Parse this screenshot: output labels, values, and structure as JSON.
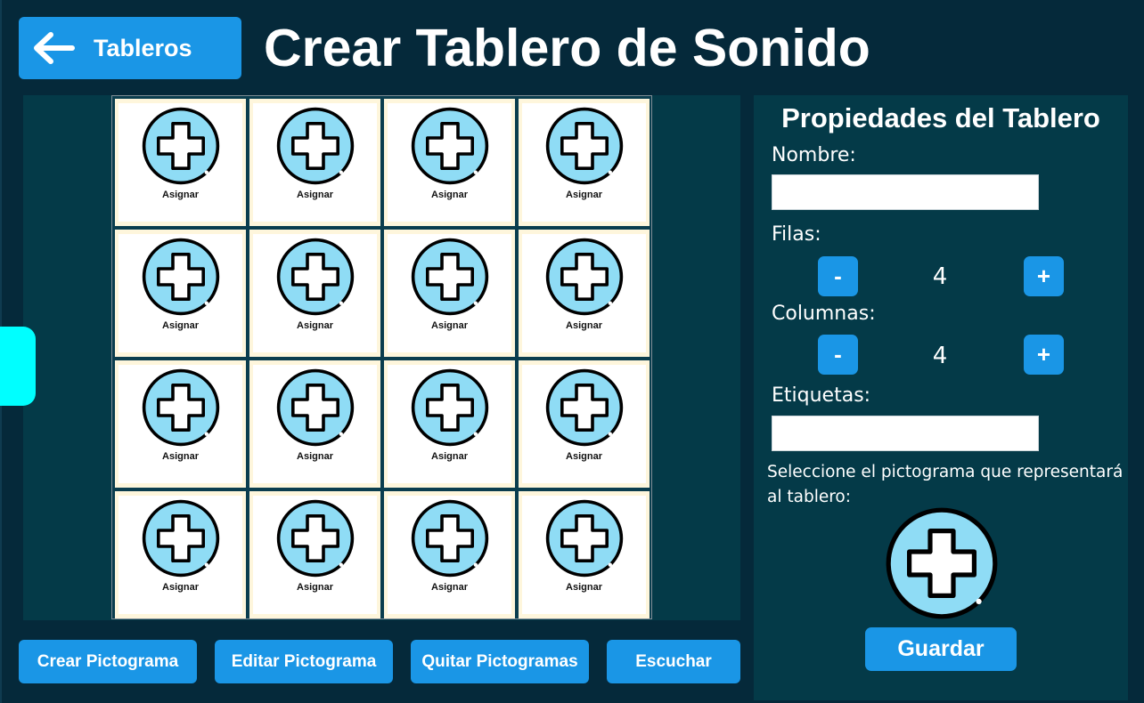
{
  "header": {
    "back_label": "Tableros",
    "title": "Crear Tablero de Sonido"
  },
  "grid": {
    "rows": 4,
    "columns": 4,
    "cells": [
      {
        "label": "Asignar"
      },
      {
        "label": "Asignar"
      },
      {
        "label": "Asignar"
      },
      {
        "label": "Asignar"
      },
      {
        "label": "Asignar"
      },
      {
        "label": "Asignar"
      },
      {
        "label": "Asignar"
      },
      {
        "label": "Asignar"
      },
      {
        "label": "Asignar"
      },
      {
        "label": "Asignar"
      },
      {
        "label": "Asignar"
      },
      {
        "label": "Asignar"
      },
      {
        "label": "Asignar"
      },
      {
        "label": "Asignar"
      },
      {
        "label": "Asignar"
      },
      {
        "label": "Asignar"
      }
    ],
    "cell_icon": "add-pictogram-icon"
  },
  "actions": {
    "create_picto": "Crear Pictograma",
    "edit_picto": "Editar Pictograma",
    "remove_pictos": "Quitar Pictogramas",
    "listen": "Escuchar"
  },
  "properties": {
    "title": "Propiedades del Tablero",
    "name_label": "Nombre:",
    "name_value": "",
    "rows_label": "Filas:",
    "rows_value": "4",
    "columns_label": "Columnas:",
    "columns_value": "4",
    "decrement": "-",
    "increment": "+",
    "tags_label": "Etiquetas:",
    "tags_value": "",
    "picto_hint": "Seleccione el pictograma que representará al tablero:",
    "board_icon": "add-pictogram-icon",
    "save_label": "Guardar"
  },
  "colors": {
    "background": "#05293a",
    "panel": "#043a48",
    "accent": "#1a96e6",
    "cell_frame": "#fef6dc",
    "icon_fill": "#8fdcf5",
    "side_tab": "#00ffff"
  }
}
